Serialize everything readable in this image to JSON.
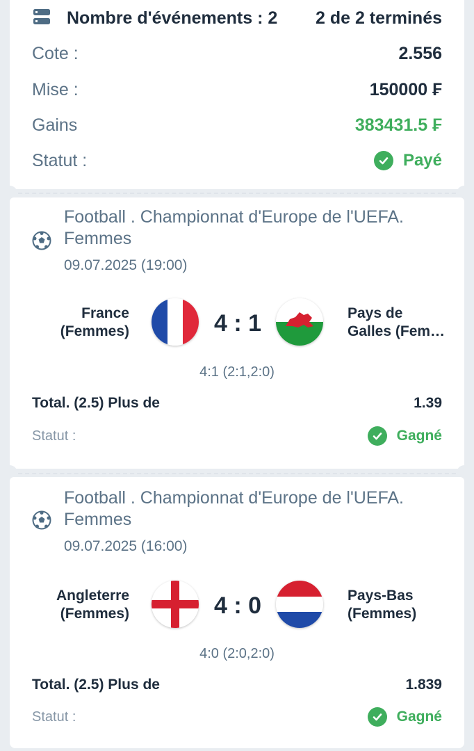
{
  "summary": {
    "events_label": "Nombre d'événements : 2",
    "completed_label": "2 de 2 terminés",
    "odds_label": "Cote :",
    "odds_value": "2.556",
    "stake_label": "Mise :",
    "stake_value": "150000 ₣",
    "winnings_label": "Gains",
    "winnings_value": "383431.5 ₣",
    "status_label": "Statut :",
    "status_value": "Payé"
  },
  "events": [
    {
      "league_line1": "Football . Championnat d'Europe de l'UEFA.",
      "league_line2": "Femmes",
      "date": "09.07.2025 (19:00)",
      "team_home_line1": "France",
      "team_home_line2": "(Femmes)",
      "team_away_line1": "Pays de",
      "team_away_line2": "Galles (Fem…",
      "score": "4 : 1",
      "score_detail": "4:1 (2:1,2:0)",
      "market": "Total. (2.5) Plus de",
      "odd": "1.39",
      "status_label": "Statut :",
      "status_value": "Gagné",
      "flag_home": "france-flag",
      "flag_away": "wales-flag"
    },
    {
      "league_line1": "Football . Championnat d'Europe de l'UEFA.",
      "league_line2": "Femmes",
      "date": "09.07.2025 (16:00)",
      "team_home_line1": "Angleterre",
      "team_home_line2": "(Femmes)",
      "team_away_line1": "Pays-Bas",
      "team_away_line2": "(Femmes)",
      "score": "4 : 0",
      "score_detail": "4:0 (2:0,2:0)",
      "market": "Total. (2.5) Plus de",
      "odd": "1.839",
      "status_label": "Statut :",
      "status_value": "Gagné",
      "flag_home": "england-flag",
      "flag_away": "netherlands-flag"
    }
  ],
  "colors": {
    "accent_green": "#3fae5d",
    "label_gray": "#5c7387",
    "text_dark": "#1f2d3d",
    "background": "#e9edf1"
  },
  "icons": [
    "list-icon",
    "football-icon",
    "check-circle-icon"
  ]
}
